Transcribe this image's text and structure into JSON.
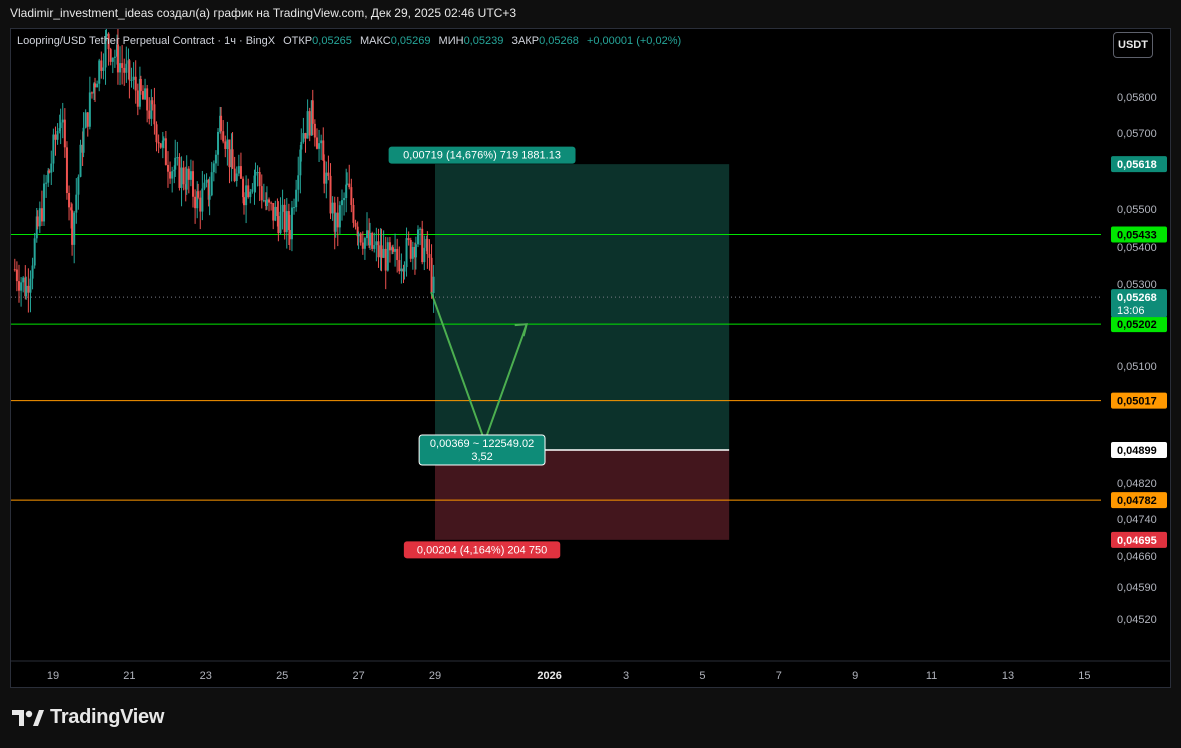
{
  "header": {
    "title": "Vladimir_investment_ideas создал(а) график на TradingView.com, Дек 29, 2025 02:46 UTC+3"
  },
  "legend": {
    "symbol": "Loopring/USD Tether Perpetual Contract · 1ч · BingX",
    "open_label": "ОТКР",
    "open": "0,05265",
    "high_label": "МАКС",
    "high": "0,05269",
    "low_label": "МИН",
    "low": "0,05239",
    "close_label": "ЗАКР",
    "close": "0,05268",
    "change": "+0,00001 (+0,02%)"
  },
  "currency_button": "USDT",
  "footer": {
    "brand": "TradingView"
  },
  "colors": {
    "up": "#26a69a",
    "down": "#ef5350",
    "green_line": "#00e600",
    "orange_line": "#ff9800",
    "target_zone": "#0e3b32",
    "stop_zone": "#4a1820",
    "target_label": "#0e8c78",
    "stop_label": "#e0323f"
  },
  "chart_data": {
    "type": "candlestick",
    "price_scale": [
      0.0452,
      0.0459,
      0.0466,
      0.0474,
      0.0482,
      0.051,
      0.053,
      0.054,
      0.055,
      0.057,
      0.058
    ],
    "price_scale_labels": [
      "0,04520",
      "0,04590",
      "0,04660",
      "0,04740",
      "0,04820",
      "0,05100",
      "0,05300",
      "0,05400",
      "0,05500",
      "0,05700",
      "0,05800"
    ],
    "x_ticks": [
      "19",
      "21",
      "23",
      "25",
      "27",
      "29",
      "2026",
      "3",
      "5",
      "7",
      "9",
      "11",
      "13",
      "15"
    ],
    "candles_close_path": [
      [
        18.0,
        0.0534
      ],
      [
        18.3,
        0.0529
      ],
      [
        18.6,
        0.0545
      ],
      [
        18.9,
        0.056
      ],
      [
        19.2,
        0.0575
      ],
      [
        19.5,
        0.0545
      ],
      [
        19.8,
        0.057
      ],
      [
        20.1,
        0.0585
      ],
      [
        20.4,
        0.0595
      ],
      [
        20.7,
        0.059
      ],
      [
        21.0,
        0.0585
      ],
      [
        21.3,
        0.058
      ],
      [
        21.6,
        0.0575
      ],
      [
        21.9,
        0.0565
      ],
      [
        22.2,
        0.056
      ],
      [
        22.5,
        0.0558
      ],
      [
        22.8,
        0.0552
      ],
      [
        23.1,
        0.0555
      ],
      [
        23.4,
        0.0575
      ],
      [
        23.7,
        0.056
      ],
      [
        24.0,
        0.0555
      ],
      [
        24.3,
        0.056
      ],
      [
        24.6,
        0.055
      ],
      [
        24.9,
        0.0548
      ],
      [
        25.2,
        0.0545
      ],
      [
        25.5,
        0.057
      ],
      [
        25.8,
        0.0575
      ],
      [
        26.1,
        0.056
      ],
      [
        26.4,
        0.0545
      ],
      [
        26.7,
        0.0555
      ],
      [
        27.0,
        0.0545
      ],
      [
        27.3,
        0.054
      ],
      [
        27.6,
        0.0538
      ],
      [
        27.9,
        0.0536
      ],
      [
        28.2,
        0.0538
      ],
      [
        28.5,
        0.0542
      ],
      [
        28.8,
        0.0538
      ],
      [
        29.0,
        0.0526
      ]
    ],
    "current_price": {
      "label": "0,05268",
      "countdown": "13:06",
      "value": 0.05268
    },
    "levels": [
      {
        "label": "0,05433",
        "value": 0.05433,
        "color": "green"
      },
      {
        "label": "0,05202",
        "value": 0.05202,
        "color": "green"
      },
      {
        "label": "0,05017",
        "value": 0.05017,
        "color": "orange"
      },
      {
        "label": "0,04782",
        "value": 0.04782,
        "color": "orange"
      }
    ],
    "position": {
      "entry": {
        "label": "0,04899",
        "value": 0.04899
      },
      "target": {
        "label": "0,05618",
        "value": 0.05618
      },
      "stop": {
        "label": "0,04695",
        "value": 0.04695
      },
      "target_text": "0,00719 (14,676%) 719 1881.13",
      "stop_text": "0,00204 (4,164%) 204 750",
      "center_line1": "0,00369 ~ 122549.02",
      "center_line2": "3,52",
      "x_start": 29.0,
      "x_end": 36.7
    },
    "projection_path": [
      [
        28.9,
        0.0528
      ],
      [
        30.3,
        0.0492
      ],
      [
        31.4,
        0.05202
      ]
    ]
  }
}
